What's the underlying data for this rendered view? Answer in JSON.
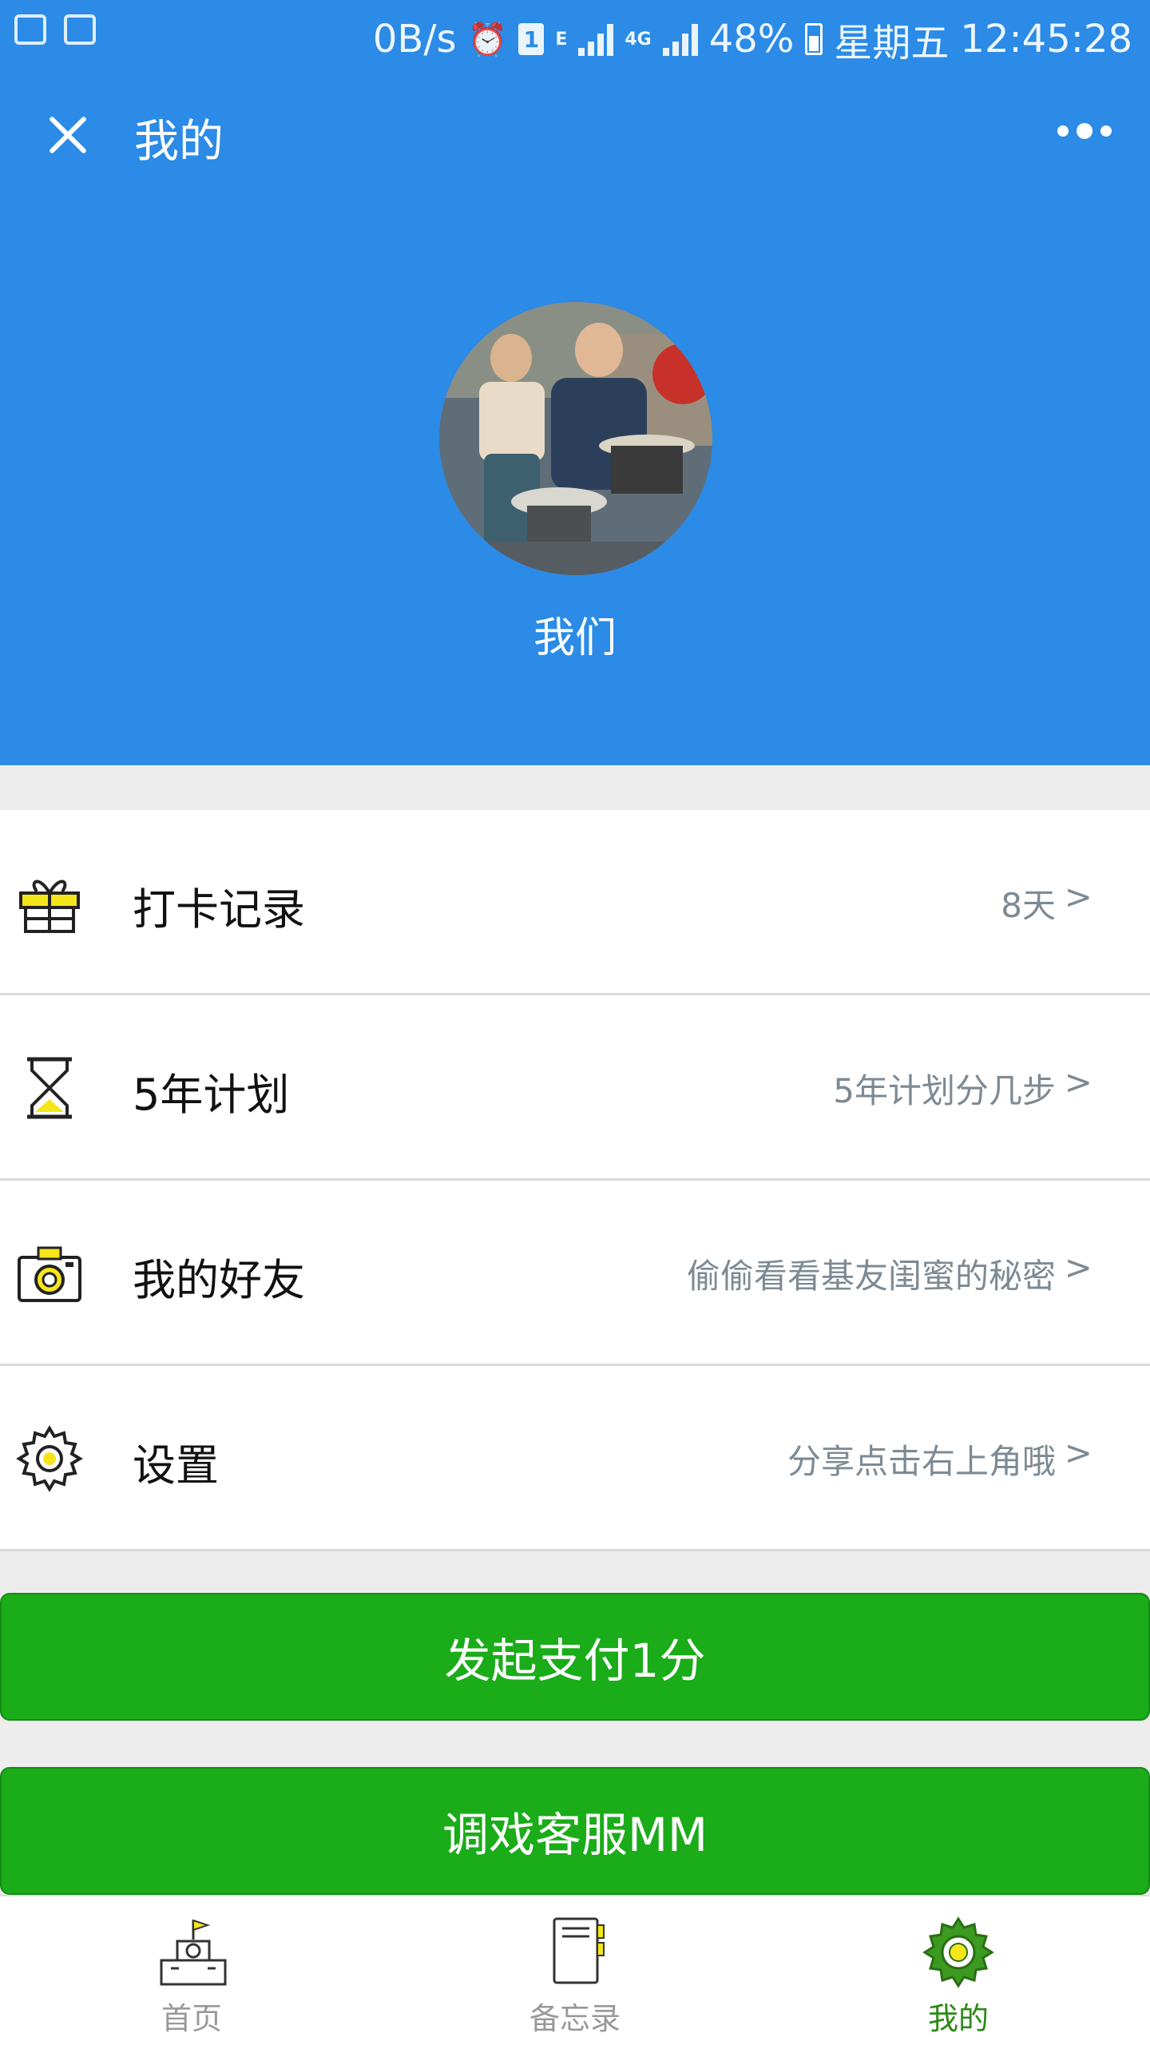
{
  "status_bar": {
    "net_speed": "0B/s",
    "sim": "1",
    "network_e": "E",
    "network_4g": "4G",
    "battery": "48%",
    "weekday": "星期五",
    "time": "12:45:28"
  },
  "nav": {
    "title": "我的"
  },
  "profile": {
    "name": "我们"
  },
  "menu": {
    "items": [
      {
        "label": "打卡记录",
        "value": "8天",
        "chevron": ">",
        "icon": "gift-icon"
      },
      {
        "label": "5年计划",
        "value": "5年计划分几步",
        "chevron": ">",
        "icon": "hourglass-icon"
      },
      {
        "label": "我的好友",
        "value": "偷偷看看基友闺蜜的秘密",
        "chevron": ">",
        "icon": "camera-icon"
      },
      {
        "label": "设置",
        "value": "分享点击右上角哦",
        "chevron": ">",
        "icon": "gear-icon"
      }
    ]
  },
  "buttons": {
    "pay": "发起支付1分",
    "service": "调戏客服MM"
  },
  "tabbar": {
    "tabs": [
      {
        "label": "首页",
        "icon": "home-building-icon",
        "active": false
      },
      {
        "label": "备忘录",
        "icon": "notebook-icon",
        "active": false
      },
      {
        "label": "我的",
        "icon": "gear-icon",
        "active": true
      }
    ]
  },
  "colors": {
    "primary_blue": "#2b8be6",
    "button_green": "#1aac19",
    "icon_yellow": "#f5e51b",
    "active_tab": "#2a8a14"
  }
}
